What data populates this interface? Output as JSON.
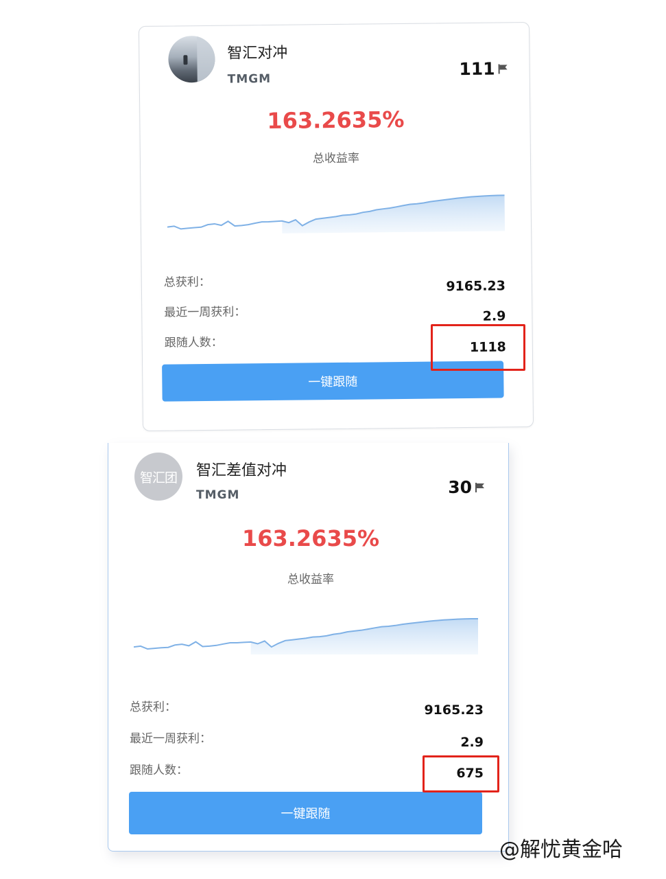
{
  "cards": [
    {
      "name": "智汇对冲",
      "broker": "TMGM",
      "count": "111",
      "return_pct": "163.2635%",
      "return_label": "总收益率",
      "stats": {
        "total_profit_label": "总获利：",
        "total_profit": "9165.23",
        "week_profit_label": "最近一周获利：",
        "week_profit": "2.9",
        "followers_label": "跟随人数：",
        "followers": "1118"
      },
      "follow_button": "一键跟随"
    },
    {
      "name": "智汇差值对冲",
      "avatar_text": "智汇团",
      "broker": "TMGM",
      "count": "30",
      "return_pct": "163.2635%",
      "return_label": "总收益率",
      "stats": {
        "total_profit_label": "总获利：",
        "total_profit": "9165.23",
        "week_profit_label": "最近一周获利：",
        "week_profit": "2.9",
        "followers_label": "跟随人数：",
        "followers": "675"
      },
      "follow_button": "一键跟随"
    }
  ],
  "sparkline": [
    1.0,
    1.4,
    0.0,
    0.3,
    0.6,
    0.8,
    2.0,
    2.4,
    1.6,
    3.6,
    1.2,
    1.4,
    1.8,
    2.5,
    3.1,
    3.1,
    3.3,
    3.5,
    2.6,
    4.0,
    1.0,
    2.8,
    4.2,
    4.6,
    5.0,
    5.4,
    6.0,
    6.2,
    6.6,
    7.4,
    7.8,
    8.6,
    9.0,
    9.4,
    10.0,
    10.6,
    11.2,
    11.4,
    11.8,
    12.4,
    12.8,
    13.2,
    13.6,
    14.0,
    14.3,
    14.6,
    14.8,
    15.0,
    15.1,
    15.2,
    15.2
  ],
  "colors": {
    "accent_red": "#e94a4a",
    "button_blue": "#4aa0f3",
    "chart_line": "#7fb1e6",
    "highlight_box": "#e2231a"
  },
  "watermark": "@解忧黄金哈"
}
